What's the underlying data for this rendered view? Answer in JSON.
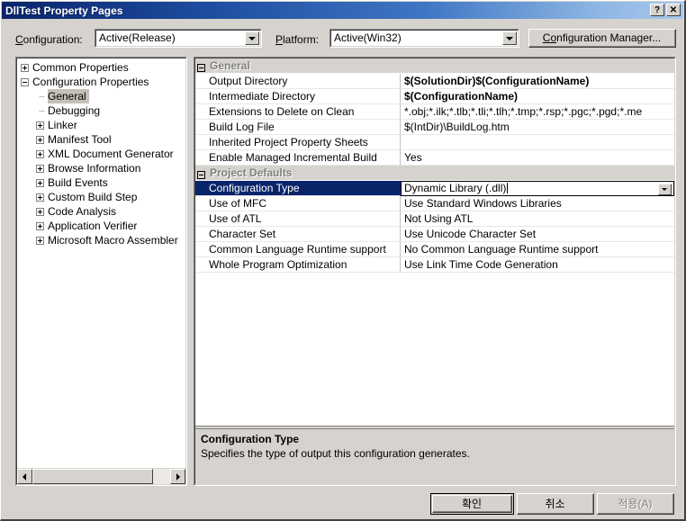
{
  "window": {
    "title": "DllTest Property Pages",
    "help_button": "?",
    "close_button": "✕"
  },
  "toolbar": {
    "configuration_label_pre": "C",
    "configuration_label_post": "onfiguration:",
    "configuration_value": "Active(Release)",
    "platform_label_pre": "P",
    "platform_label_post": "latform:",
    "platform_value": "Active(Win32)",
    "config_manager_pre": "C",
    "config_manager_mid": "o",
    "config_manager_post": "nfiguration Manager..."
  },
  "tree": {
    "items": [
      {
        "label": "Common Properties",
        "indent": 0,
        "marker": "plus",
        "selected": false
      },
      {
        "label": "Configuration Properties",
        "indent": 0,
        "marker": "minus",
        "selected": false
      },
      {
        "label": "General",
        "indent": 1,
        "marker": "dots",
        "selected": true
      },
      {
        "label": "Debugging",
        "indent": 1,
        "marker": "dots",
        "selected": false
      },
      {
        "label": "Linker",
        "indent": 1,
        "marker": "plus",
        "selected": false
      },
      {
        "label": "Manifest Tool",
        "indent": 1,
        "marker": "plus",
        "selected": false
      },
      {
        "label": "XML Document Generator",
        "indent": 1,
        "marker": "plus",
        "selected": false
      },
      {
        "label": "Browse Information",
        "indent": 1,
        "marker": "plus",
        "selected": false
      },
      {
        "label": "Build Events",
        "indent": 1,
        "marker": "plus",
        "selected": false
      },
      {
        "label": "Custom Build Step",
        "indent": 1,
        "marker": "plus",
        "selected": false
      },
      {
        "label": "Code Analysis",
        "indent": 1,
        "marker": "plus",
        "selected": false
      },
      {
        "label": "Application Verifier",
        "indent": 1,
        "marker": "plus",
        "selected": false
      },
      {
        "label": "Microsoft Macro Assembler",
        "indent": 1,
        "marker": "plus",
        "selected": false
      }
    ]
  },
  "grid": {
    "rows": [
      {
        "kind": "category",
        "label": "General"
      },
      {
        "kind": "prop",
        "key": "Output Directory",
        "value": "$(SolutionDir)$(ConfigurationName)",
        "bold": true
      },
      {
        "kind": "prop",
        "key": "Intermediate Directory",
        "value": "$(ConfigurationName)",
        "bold": true
      },
      {
        "kind": "prop",
        "key": "Extensions to Delete on Clean",
        "value": "*.obj;*.ilk;*.tlb;*.tli;*.tlh;*.tmp;*.rsp;*.pgc;*.pgd;*.me",
        "bold": false
      },
      {
        "kind": "prop",
        "key": "Build Log File",
        "value": "$(IntDir)\\BuildLog.htm",
        "bold": false
      },
      {
        "kind": "prop",
        "key": "Inherited Project Property Sheets",
        "value": "",
        "bold": false
      },
      {
        "kind": "prop",
        "key": "Enable Managed Incremental Build",
        "value": "Yes",
        "bold": false
      },
      {
        "kind": "category",
        "label": "Project Defaults"
      },
      {
        "kind": "prop",
        "key": "Configuration Type",
        "value": "Dynamic Library (.dll)",
        "bold": false,
        "selected": true,
        "editing": true
      },
      {
        "kind": "prop",
        "key": "Use of MFC",
        "value": "Use Standard Windows Libraries",
        "bold": false
      },
      {
        "kind": "prop",
        "key": "Use of ATL",
        "value": "Not Using ATL",
        "bold": false
      },
      {
        "kind": "prop",
        "key": "Character Set",
        "value": "Use Unicode Character Set",
        "bold": false
      },
      {
        "kind": "prop",
        "key": "Common Language Runtime support",
        "value": "No Common Language Runtime support",
        "bold": false
      },
      {
        "kind": "prop",
        "key": "Whole Program Optimization",
        "value": "Use Link Time Code Generation",
        "bold": false
      }
    ],
    "description": {
      "title": "Configuration Type",
      "body": "Specifies the type of output this configuration generates."
    }
  },
  "buttons": {
    "ok": "확인",
    "cancel": "취소",
    "apply": "적용(A)"
  },
  "colors": {
    "dialog_face": "#d6d3ce",
    "title_start": "#0a246a",
    "title_end": "#a6c8ec",
    "selection": "#0a246a",
    "category_text": "#808080"
  }
}
